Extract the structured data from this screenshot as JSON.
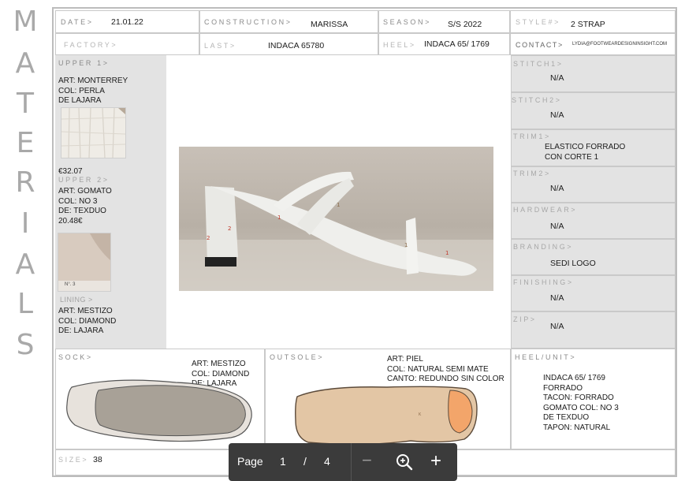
{
  "side_title": [
    "M",
    "A",
    "T",
    "E",
    "R",
    "I",
    "A",
    "L",
    "S"
  ],
  "header": {
    "date_label": "DATE>",
    "date_value": "21.01.22",
    "construction_label": "CONSTRUCTION>",
    "construction_value": "MARISSA",
    "season_label": "SEASON>",
    "season_value": "S/S 2022",
    "style_label": "STYLE#>",
    "style_value": "2 STRAP",
    "factory_label": "FACTORY>",
    "last_label": "LAST>",
    "last_value": "INDACA 65780",
    "heel_label": "HEEL>",
    "heel_value": "INDACA 65/ 1769",
    "contact_label": "CONTACT>",
    "contact_value": "LYDIA@FOOTWEARDESIGNINSIGHT.COM"
  },
  "left": {
    "upper1_label": "UPPER 1>",
    "upper1_lines": [
      "ART: MONTERREY",
      "COL: PERLA",
      "DE LAJARA"
    ],
    "upper1_price": "€32.07",
    "upper2_label": "UPPER 2>",
    "upper2_lines": [
      "ART: GOMATO",
      "COL: NO 3",
      "DE: TEXDUO",
      "20.48€"
    ],
    "upper2_swatch_tag": "N°. 3",
    "lining_label": "LINING >",
    "lining_lines": [
      "ART: MESTIZO",
      "COL: DIAMOND",
      "DE: LAJARA"
    ]
  },
  "right": [
    {
      "label": "STITCH1>",
      "lines": [
        "N/A"
      ]
    },
    {
      "label": "STITCH2>",
      "lines": [
        "N/A"
      ]
    },
    {
      "label": "TRIM1>",
      "lines": [
        "ELASTICO FORRADO",
        "CON CORTE 1"
      ]
    },
    {
      "label": "TRIM2>",
      "lines": [
        "N/A"
      ]
    },
    {
      "label": "HARDWEAR>",
      "lines": [
        "N/A"
      ]
    },
    {
      "label": "BRANDING>",
      "lines": [
        "SEDI LOGO"
      ]
    },
    {
      "label": "FINISHING>",
      "lines": [
        "N/A"
      ]
    },
    {
      "label": "ZIP>",
      "lines": [
        "N/A"
      ]
    }
  ],
  "photo_markers": [
    "1",
    "1",
    "2",
    "2",
    "1",
    "1"
  ],
  "bottom": {
    "sock_label": "SOCK>",
    "sock_lines": [
      "ART: MESTIZO",
      "COL: DIAMOND",
      "DE: LAJARA"
    ],
    "outsole_label": "OUTSOLE>",
    "outsole_lines": [
      "ART: PIEL",
      "COL: NATURAL SEMI MATE",
      "CANTO: REDUNDO SIN COLOR"
    ],
    "outsole_mark": "K",
    "heelunit_label": "HEEL/UNIT>",
    "heelunit_lines": [
      "INDACA 65/ 1769",
      "FORRADO",
      "TACON: FORRADO",
      "GOMATO COL: NO 3",
      "DE TEXDUO",
      "TAPON: NATURAL"
    ],
    "size_label": "SIZE>",
    "size_value": "38"
  },
  "toolbar": {
    "page_label": "Page",
    "page_current": "1",
    "page_sep": "/",
    "page_total": "4",
    "zoom_out": "−",
    "zoom_in": "+"
  },
  "colors": {
    "gray_panel": "#e3e3e3",
    "border": "#c9c9c9",
    "label_gray": "#8a8a8a",
    "sock_insole": "#a8a197",
    "sock_edge": "#e7e2dc",
    "outsole_fill": "#e3c6a5",
    "outsole_edge": "#5b4a3a",
    "heel_pad": "#f3a56a",
    "toolbar_bg": "#3b3b3b",
    "photo_marker": "#c0392b"
  }
}
